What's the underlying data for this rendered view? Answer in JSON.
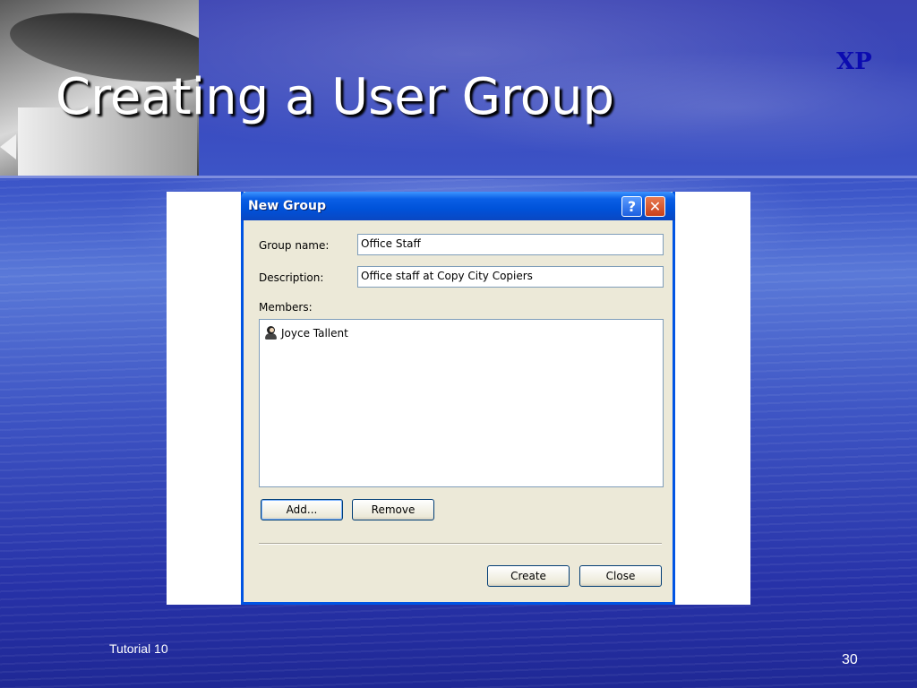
{
  "slide": {
    "title": "Creating a User Group",
    "corner_label": "XP",
    "footer_left": "Tutorial 10",
    "page_number": "30"
  },
  "dialog": {
    "title": "New Group",
    "help_label": "?",
    "close_label": "✕",
    "group_name_label": "Group name:",
    "group_name_value": "Office Staff",
    "description_label": "Description:",
    "description_value": "Office staff at Copy City Copiers",
    "members_label": "Members:",
    "members": [
      "Joyce Tallent"
    ],
    "buttons": {
      "add": "Add...",
      "remove": "Remove",
      "create": "Create",
      "close": "Close"
    }
  },
  "colors": {
    "slide_background": "#3d57c9",
    "titlebar_blue": "#0052d9",
    "dialog_face": "#ece9d8",
    "xp_label": "#0b0bb0"
  },
  "icons": {
    "member": "user-icon",
    "help": "help-icon",
    "close": "close-icon"
  }
}
